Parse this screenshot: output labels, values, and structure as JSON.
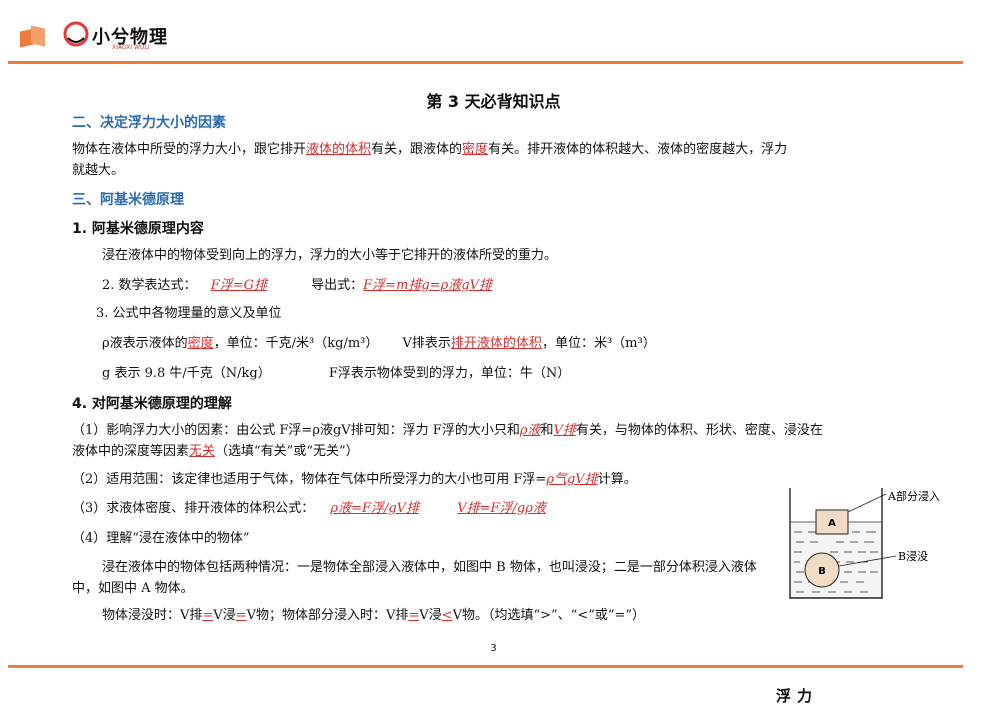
{
  "header": {
    "brand_name": "小兮物理",
    "brand_sub": "XIAOXI WULI",
    "icon": "brand-logo-icon"
  },
  "title": "第 3 天必背知识点",
  "section2": {
    "heading": "二、决定浮力大小的因素",
    "p1_a": "物体在液体中所受的浮力大小，跟它排开",
    "p1_b": "液体的体积",
    "p1_c": "有关，跟液体的",
    "p1_d": "密度",
    "p1_e": "有关。排开液体的体积越大、液体的密度越大，浮力",
    "p1_f": "就越大。"
  },
  "section3": {
    "heading": "三、阿基米德原理",
    "s1_heading": "1. 阿基米德原理内容",
    "s1_text": "浸在液体中的物体受到向上的浮力，浮力的大小等于它排开的液体所受的重力。",
    "s2_label": "2. 数学表达式：",
    "s2_formula": "F浮=G排",
    "s2_derived_label": "导出式：",
    "s2_derived": "F浮=m排g=ρ液gV排",
    "s3_label": "3. 公式中各物理量的意义及单位",
    "rho_a": "ρ液表示液体的",
    "rho_b": "密度",
    "rho_c": "，单位：千克/米³（kg/m³）",
    "v_a": "V排表示",
    "v_b": "排开液体的体积",
    "v_c": "，单位：米³（m³）",
    "g_text": "g 表示 9.8 牛/千克（N/kg）",
    "f_text": "F浮表示物体受到的浮力，单位：牛（N）"
  },
  "section4": {
    "heading": "4. 对阿基米德原理的理解",
    "p1_a": "（1）影响浮力大小的因素：由公式 F浮=ρ液gV排可知：浮力 F浮的大小只和",
    "p1_b": "ρ液",
    "p1_c": "和",
    "p1_d": "V排",
    "p1_e": "有关，与物体的体积、形状、密度、浸没在",
    "p1_f": "液体中的深度等因素",
    "p1_g": "无关",
    "p1_h": "（选填“有关”或“无关”）",
    "p2_a": "（2）适用范围：该定律也适用于气体，物体在气体中所受浮力的大小也可用 F浮=",
    "p2_b": "ρ气gV排",
    "p2_c": "计算。",
    "p3_a": "（3）求液体密度、排开液体的体积公式：",
    "p3_b": "ρ液=F浮/gV排",
    "p3_c": "V排=F浮/gρ液",
    "p4": "（4）理解“浸在液体中的物体”",
    "p5_a": "浸在液体中的物体包括两种情况：一是物体全部浸入液体中，如图中 B 物体，也叫浸没；二是一部分体",
    "p5_b": "积浸入液体中，如图中 A 物体。",
    "p6_a": "物体浸没时：V排",
    "p6_b": "=",
    "p6_c": "V浸",
    "p6_d": "=",
    "p6_e": "V物；物体部分浸入时：V排",
    "p6_f": "=",
    "p6_g": "V浸",
    "p6_h": "<",
    "p6_i": "V物。（均选填“>”、“<”或“=”）"
  },
  "figure": {
    "label_a": "A部分浸入",
    "label_b": "B浸没",
    "block_a": "A",
    "ball_b": "B"
  },
  "page_number": "3",
  "footer": "浮力"
}
